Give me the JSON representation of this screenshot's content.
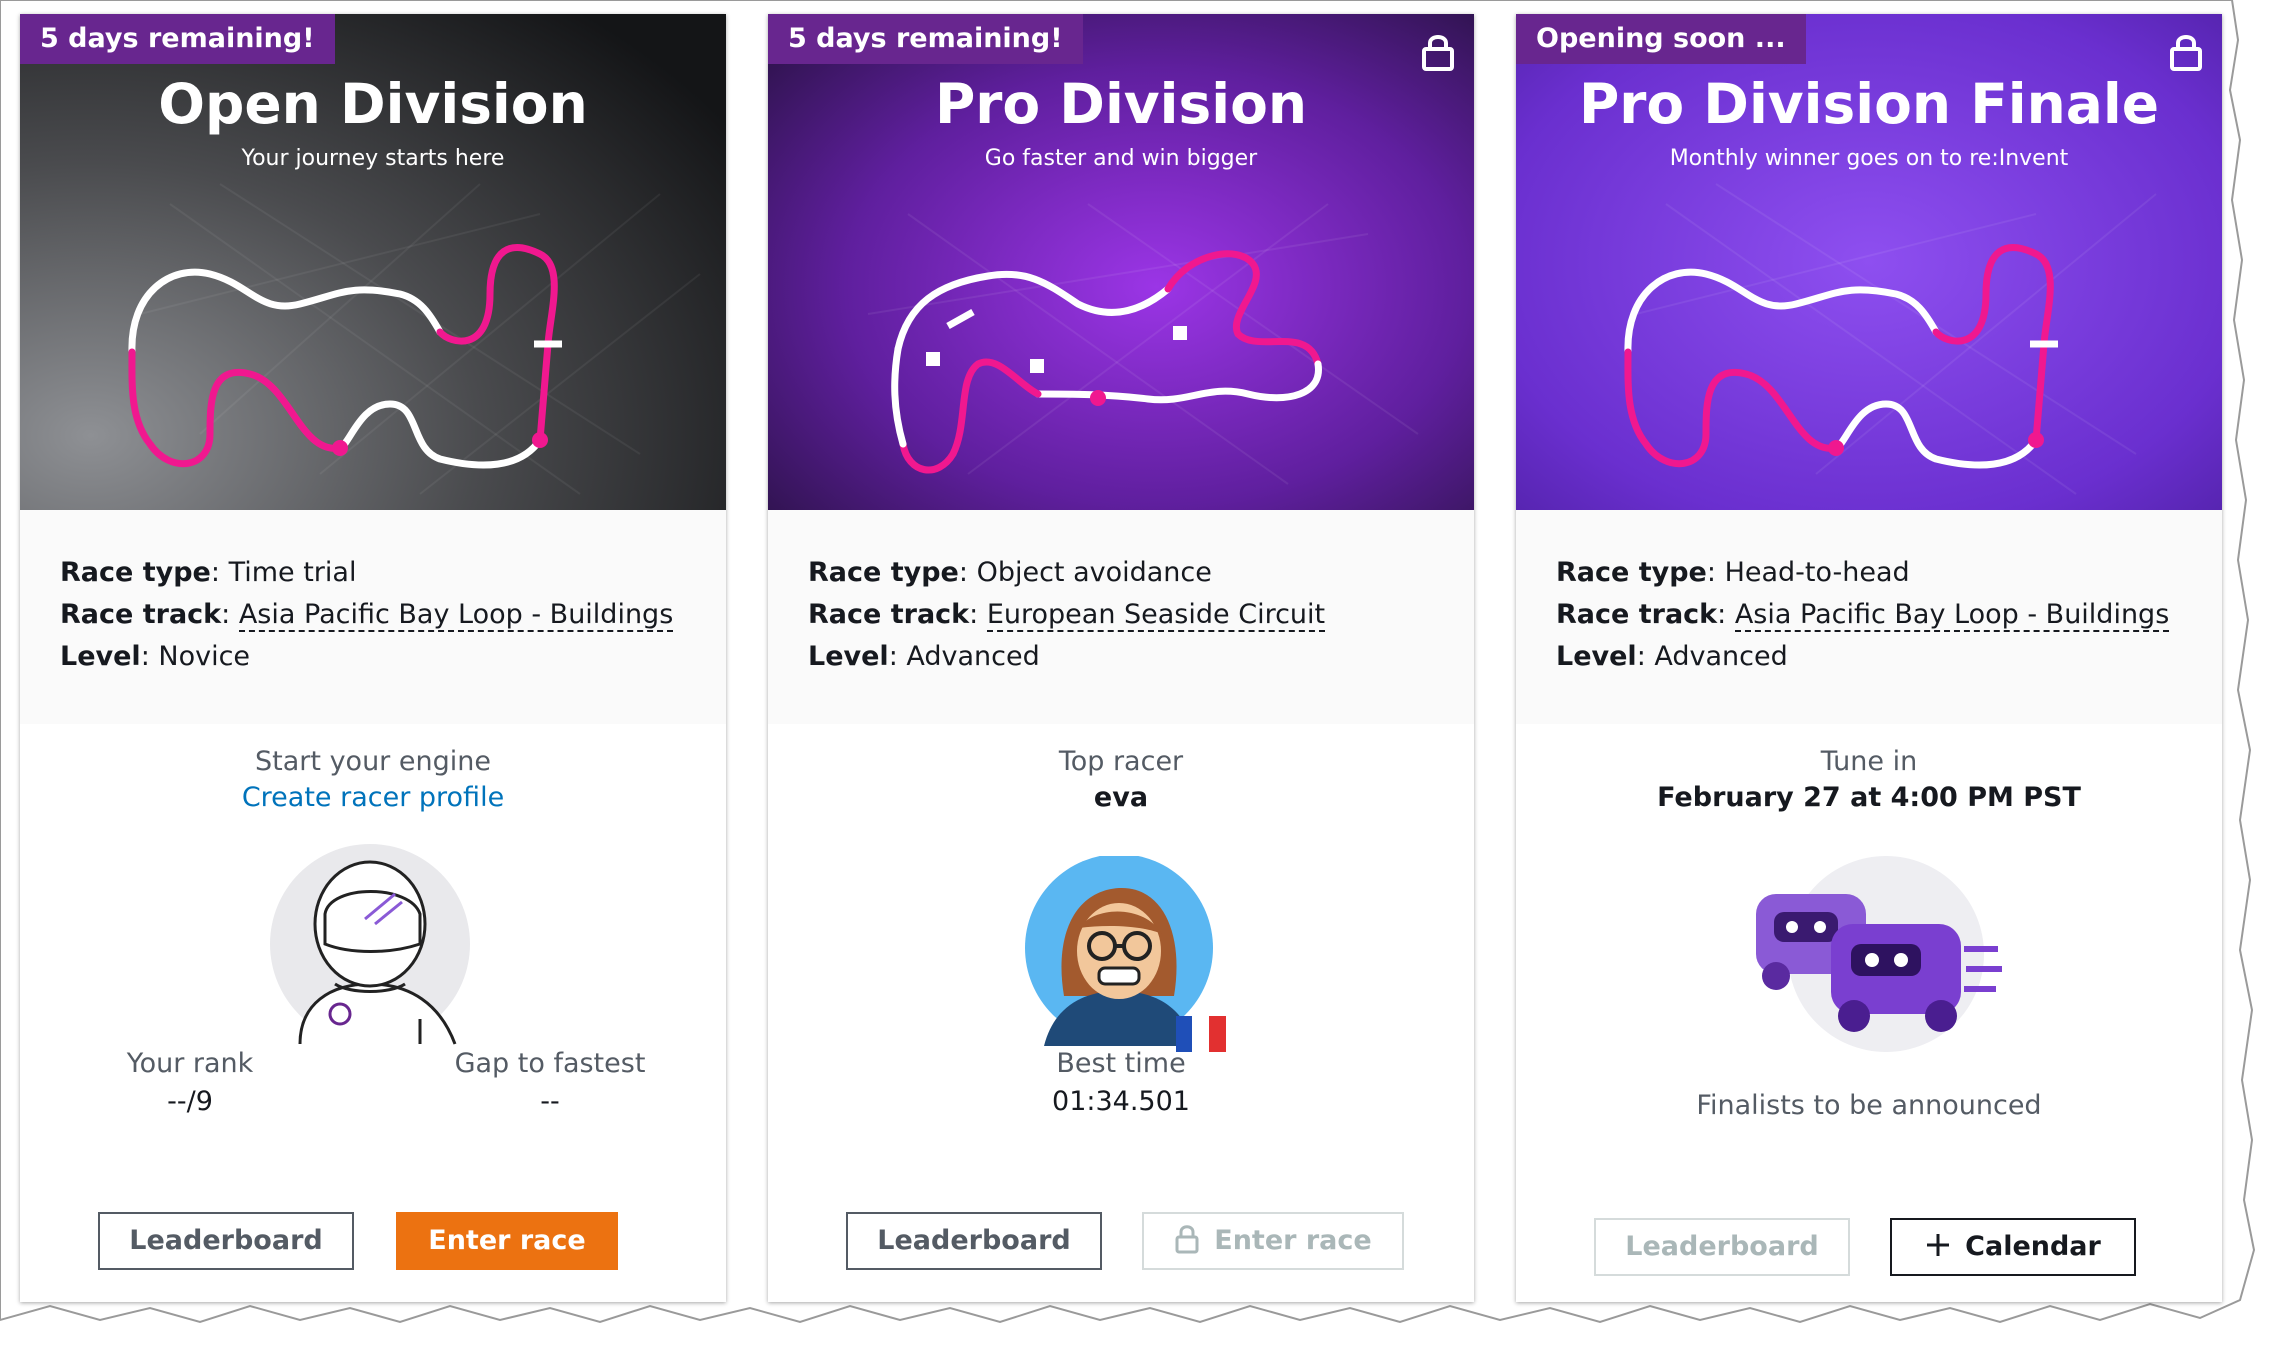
{
  "cards": [
    {
      "badge": "5 days remaining!",
      "locked": false,
      "title": "Open Division",
      "subtitle": "Your journey starts here",
      "race_type_label": "Race type",
      "race_type": "Time trial",
      "race_track_label": "Race track",
      "race_track": "Asia Pacific Bay Loop - Buildings",
      "level_label": "Level",
      "level": "Novice",
      "heading": "Start your engine",
      "cta_link": "Create racer profile",
      "rank_label": "Your rank",
      "rank_value": "--/9",
      "gap_label": "Gap to fastest",
      "gap_value": "--",
      "btn_leaderboard": "Leaderboard",
      "btn_enter": "Enter race",
      "hero_colors": [
        "#7a7c80",
        "#1a1b1d"
      ]
    },
    {
      "badge": "5 days remaining!",
      "locked": true,
      "title": "Pro Division",
      "subtitle": "Go faster and win bigger",
      "race_type_label": "Race type",
      "race_type": "Object avoidance",
      "race_track_label": "Race track",
      "race_track": "European Seaside Circuit",
      "level_label": "Level",
      "level": "Advanced",
      "heading": "Top racer",
      "racer_name": "eva",
      "best_time_label": "Best time",
      "best_time": "01:34.501",
      "btn_leaderboard": "Leaderboard",
      "btn_enter": "Enter race",
      "hero_colors": [
        "#8a2bd6",
        "#2c1046"
      ]
    },
    {
      "badge": "Opening soon ...",
      "locked": true,
      "title": "Pro Division Finale",
      "subtitle": "Monthly winner goes on to re:Invent",
      "race_type_label": "Race type",
      "race_type": "Head-to-head",
      "race_track_label": "Race track",
      "race_track": "Asia Pacific Bay Loop - Buildings",
      "level_label": "Level",
      "level": "Advanced",
      "heading": "Tune in",
      "event_time": "February 27 at 4:00 PM PST",
      "finalists_text": "Finalists to be announced",
      "btn_leaderboard": "Leaderboard",
      "btn_calendar": "Calendar",
      "hero_colors": [
        "#7b3fe4",
        "#4a1f9a"
      ]
    }
  ],
  "colors": {
    "badge": "#68268f",
    "track_pink": "#f0188f",
    "primary_button": "#ec7211",
    "link": "#0073bb"
  },
  "icons": {
    "lock": "lock-icon",
    "plus": "plus-icon",
    "flag": "france-flag-icon"
  }
}
